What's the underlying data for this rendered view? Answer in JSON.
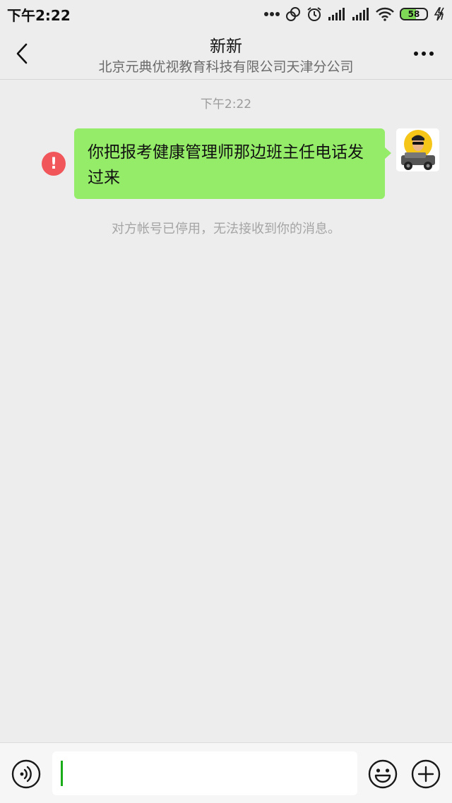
{
  "status_bar": {
    "time": "下午2:22",
    "battery": "58",
    "battery_level": 0.58
  },
  "header": {
    "back_icon": "chevron-left-icon",
    "title": "新新",
    "subtitle": "北京元典优视教育科技有限公司天津分公司",
    "more_icon": "more-dots-icon"
  },
  "messages": [
    {
      "timestamp": "下午2:22",
      "text": "你把报考健康管理师那边班主任电话发过来",
      "status": "failed",
      "error_glyph": "!"
    }
  ],
  "system_note": "对方帐号已停用，无法接收到你的消息。",
  "input_bar": {
    "value": "",
    "voice_icon": "voice-icon",
    "emoji_icon": "emoji-icon",
    "plus_icon": "plus-icon"
  },
  "colors": {
    "background": "#ededed",
    "bubble": "#95ec69",
    "error": "#f0565a",
    "caret": "#1aad19"
  }
}
